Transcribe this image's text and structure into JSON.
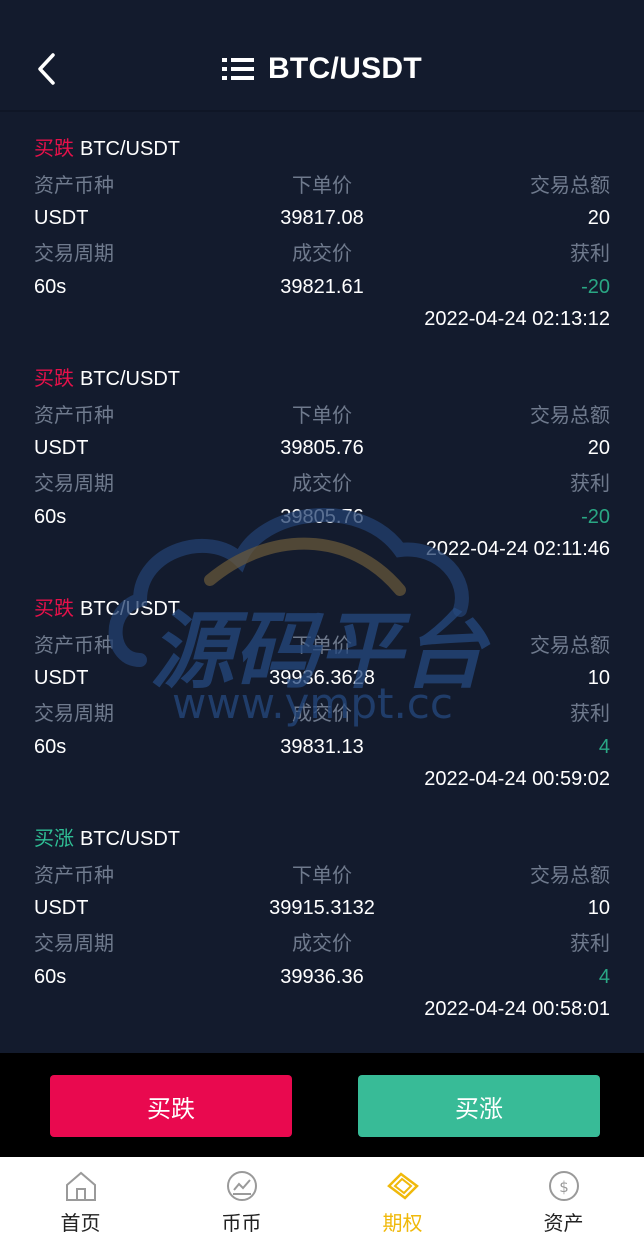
{
  "header": {
    "title": "BTC/USDT"
  },
  "labels": {
    "asset": "资产币种",
    "order_price": "下单价",
    "total": "交易总额",
    "period": "交易周期",
    "deal_price": "成交价",
    "profit": "获利"
  },
  "orders": [
    {
      "direction": "买跌",
      "pair": "BTC/USDT",
      "asset": "USDT",
      "order_price": "39817.08",
      "total": "20",
      "period": "60s",
      "deal_price": "39821.61",
      "profit": "-20",
      "time": "2022-04-24 02:13:12"
    },
    {
      "direction": "买跌",
      "pair": "BTC/USDT",
      "asset": "USDT",
      "order_price": "39805.76",
      "total": "20",
      "period": "60s",
      "deal_price": "39805.76",
      "profit": "-20",
      "time": "2022-04-24 02:11:46"
    },
    {
      "direction": "买跌",
      "pair": "BTC/USDT",
      "asset": "USDT",
      "order_price": "39936.3628",
      "total": "10",
      "period": "60s",
      "deal_price": "39831.13",
      "profit": "4",
      "time": "2022-04-24 00:59:02"
    },
    {
      "direction": "买涨",
      "pair": "BTC/USDT",
      "asset": "USDT",
      "order_price": "39915.3132",
      "total": "10",
      "period": "60s",
      "deal_price": "39936.36",
      "profit": "4",
      "time": "2022-04-24 00:58:01"
    }
  ],
  "watermark": {
    "text": "源码平台",
    "url": "www.ympt.cc"
  },
  "actions": {
    "fall": "买跌",
    "rise": "买涨"
  },
  "tabs": [
    {
      "label": "首页",
      "icon": "home-icon"
    },
    {
      "label": "币币",
      "icon": "trend-chart-icon"
    },
    {
      "label": "期权",
      "icon": "diamond-icon",
      "active": true
    },
    {
      "label": "资产",
      "icon": "dollar-icon"
    }
  ],
  "colors": {
    "background": "#131b2d",
    "fall": "#e9094f",
    "rise": "#38bb97",
    "active_tab": "#f0b90b"
  }
}
